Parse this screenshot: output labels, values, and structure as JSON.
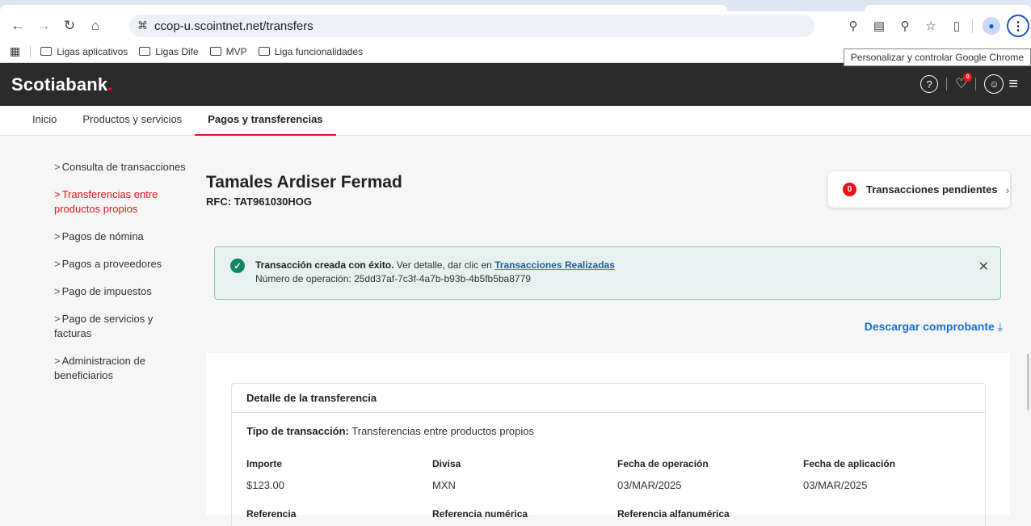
{
  "browser": {
    "url": "ccop-u.scointnet.net/transfers",
    "tooltip": "Personalizar y controlar Google Chrome",
    "bookmarks": [
      "Ligas aplicativos",
      "Ligas Dife",
      "MVP",
      "Liga funcionalidades"
    ]
  },
  "header": {
    "logo": "Scotiabank",
    "logo_dot": ".",
    "help": "?",
    "bell_badge": "0"
  },
  "nav": {
    "tabs": [
      "Inicio",
      "Productos y servicios",
      "Pagos y transferencias"
    ]
  },
  "sidebar": {
    "items": [
      {
        "label": "Consulta de transacciones"
      },
      {
        "label": "Transferencias entre productos propios"
      },
      {
        "label": "Pagos de nómina"
      },
      {
        "label": "Pagos a proveedores"
      },
      {
        "label": "Pago de impuestos"
      },
      {
        "label": "Pago de servicios y facturas"
      },
      {
        "label": "Administracion de beneficiarios"
      }
    ]
  },
  "client": {
    "name": "Tamales Ardiser Fermad",
    "rfc": "RFC: TAT961030HOG"
  },
  "pending": {
    "count": "0",
    "label": "Transacciones pendientes"
  },
  "alert": {
    "title": "Transacción creada con éxito.",
    "text": " Ver detalle, dar clic en ",
    "link": "Transacciones Realizadas",
    "operation": "Número de operación: 25dd37af-7c3f-4a7b-b93b-4b5fb5ba8779"
  },
  "download": {
    "label": "Descargar comprobante"
  },
  "detail": {
    "title": "Detalle de la transferencia",
    "type_label": "Tipo de transacción:",
    "type_value": " Transferencias entre productos propios",
    "fields": [
      {
        "label": "Importe",
        "value": "$123.00"
      },
      {
        "label": "Divisa",
        "value": "MXN"
      },
      {
        "label": "Fecha de operación",
        "value": "03/MAR/2025"
      },
      {
        "label": "Fecha de aplicación",
        "value": "03/MAR/2025"
      }
    ],
    "row2": [
      "Referencia",
      "Referencia numérica",
      "Referencia alfanumérica"
    ]
  },
  "colors": {
    "brand_red": "#ec111a",
    "header_bg": "#2b2b2b",
    "success_green": "#138468",
    "link_blue": "#1a6fd1"
  }
}
